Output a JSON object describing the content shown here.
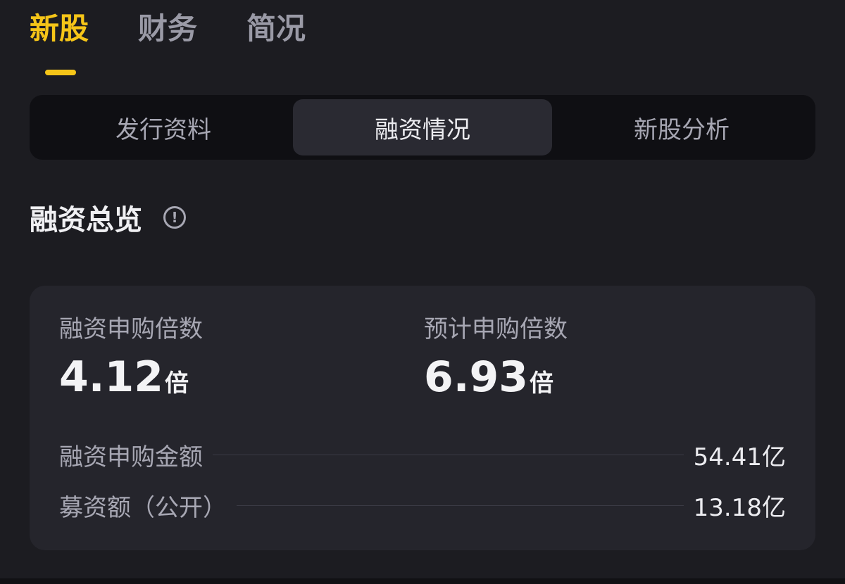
{
  "top_tabs": [
    {
      "label": "新股",
      "active": true
    },
    {
      "label": "财务",
      "active": false
    },
    {
      "label": "简况",
      "active": false
    }
  ],
  "segments": [
    {
      "label": "发行资料",
      "active": false
    },
    {
      "label": "融资情况",
      "active": true
    },
    {
      "label": "新股分析",
      "active": false
    }
  ],
  "section": {
    "title": "融资总览",
    "info_icon": "info-circle-icon",
    "info_glyph": "!"
  },
  "metrics": {
    "margin_multiple": {
      "label": "融资申购倍数",
      "value": "4.12",
      "unit": "倍"
    },
    "expected_multiple": {
      "label": "预计申购倍数",
      "value": "6.93",
      "unit": "倍"
    }
  },
  "rows": {
    "margin_amount": {
      "label": "融资申购金额",
      "value": "54.41亿"
    },
    "public_raise": {
      "label": "募资额（公开）",
      "value": "13.18亿"
    }
  },
  "colors": {
    "accent": "#f5c518",
    "background": "#1c1c21",
    "card": "#25252c"
  }
}
